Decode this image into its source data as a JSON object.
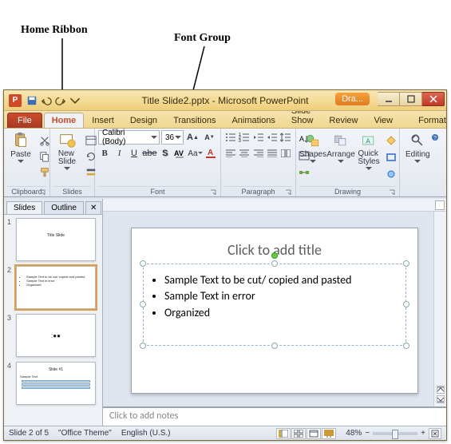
{
  "annotations": {
    "home_ribbon": "Home Ribbon",
    "font_group": "Font Group"
  },
  "titlebar": {
    "title": "Title Slide2.pptx - Microsoft PowerPoint",
    "help_tag": "Dra..."
  },
  "tabs": {
    "file": "File",
    "items": [
      "Home",
      "Insert",
      "Design",
      "Transitions",
      "Animations",
      "Slide Show",
      "Review",
      "View",
      "Format"
    ],
    "active": "Home"
  },
  "ribbon": {
    "clipboard": {
      "label": "Clipboard",
      "paste": "Paste"
    },
    "slides": {
      "label": "Slides",
      "newslide": "New\nSlide"
    },
    "font": {
      "label": "Font",
      "name": "Calibri (Body)",
      "size": "36"
    },
    "paragraph": {
      "label": "Paragraph"
    },
    "drawing": {
      "label": "Drawing",
      "shapes": "Shapes",
      "arrange": "Arrange",
      "quick": "Quick\nStyles"
    },
    "editing": {
      "label": "Editing",
      "btn": "Editing"
    }
  },
  "panel": {
    "tabs": [
      "Slides",
      "Outline"
    ],
    "active": "Slides"
  },
  "thumbs": [
    {
      "n": "1",
      "title_center": "Title Slide"
    },
    {
      "n": "2",
      "bullets": [
        "Sample Text to be cut/ copied and pasted",
        "Sample Text in error",
        "Organized"
      ]
    },
    {
      "n": "3",
      "dots": ":●●"
    },
    {
      "n": "4",
      "title": "Slide #1",
      "subtitle": "Sample Text",
      "table": true
    }
  ],
  "slide": {
    "title_placeholder": "Click to add title",
    "bullets": [
      "Sample Text to be cut/ copied and pasted",
      "Sample Text in error",
      "Organized"
    ]
  },
  "notes": {
    "placeholder": "Click to add notes"
  },
  "status": {
    "slide_of": "Slide 2 of 5",
    "theme": "\"Office Theme\"",
    "lang": "English (U.S.)",
    "zoom": "48%"
  }
}
